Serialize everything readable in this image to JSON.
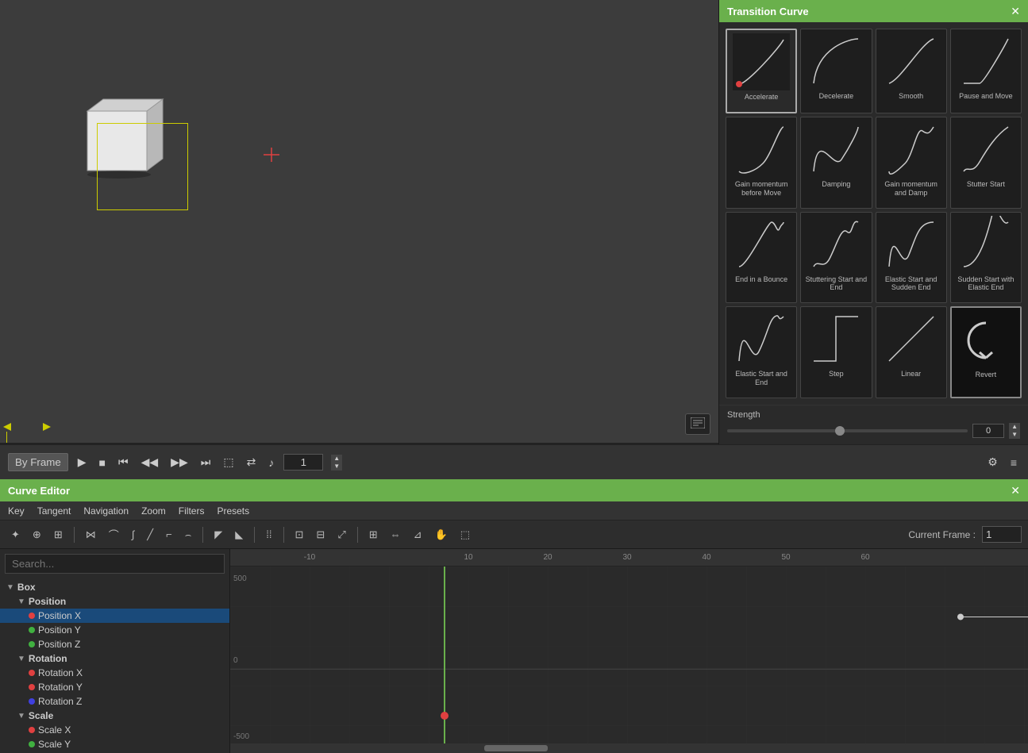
{
  "transition_panel": {
    "title": "Transition Curve",
    "close_btn": "✕",
    "curves": [
      {
        "id": "accelerate",
        "label": "Accelerate",
        "selected": true,
        "curve_type": "accelerate"
      },
      {
        "id": "decelerate",
        "label": "Decelerate",
        "selected": false,
        "curve_type": "decelerate"
      },
      {
        "id": "smooth",
        "label": "Smooth",
        "selected": false,
        "curve_type": "smooth"
      },
      {
        "id": "pause-move",
        "label": "Pause and Move",
        "selected": false,
        "curve_type": "pause_move"
      },
      {
        "id": "gain-momentum",
        "label": "Gain momentum before Move",
        "selected": false,
        "curve_type": "gain_momentum"
      },
      {
        "id": "damping",
        "label": "Damping",
        "selected": false,
        "curve_type": "damping"
      },
      {
        "id": "gain-damp",
        "label": "Gain momentum and Damp",
        "selected": false,
        "curve_type": "gain_damp"
      },
      {
        "id": "stutter-start",
        "label": "Stutter Start",
        "selected": false,
        "curve_type": "stutter_start"
      },
      {
        "id": "end-bounce",
        "label": "End in a Bounce",
        "selected": false,
        "curve_type": "end_bounce"
      },
      {
        "id": "stutter-start-end",
        "label": "Stuttering Start and End",
        "selected": false,
        "curve_type": "stutter_start_end"
      },
      {
        "id": "elastic-sudden",
        "label": "Elastic Start and Sudden End",
        "selected": false,
        "curve_type": "elastic_sudden"
      },
      {
        "id": "sudden-elastic",
        "label": "Sudden Start with Elastic End",
        "selected": false,
        "curve_type": "sudden_elastic"
      },
      {
        "id": "elastic-both",
        "label": "Elastic Start and End",
        "selected": false,
        "curve_type": "elastic_both"
      },
      {
        "id": "step",
        "label": "Step",
        "selected": false,
        "curve_type": "step"
      },
      {
        "id": "linear",
        "label": "Linear",
        "selected": false,
        "curve_type": "linear"
      },
      {
        "id": "revert",
        "label": "Revert",
        "selected": false,
        "dark": true,
        "curve_type": "revert"
      }
    ],
    "strength": {
      "label": "Strength",
      "value": "0"
    }
  },
  "curve_editor": {
    "title": "Curve Editor",
    "close_btn": "✕",
    "menu_items": [
      "Key",
      "Tangent",
      "Navigation",
      "Zoom",
      "Filters",
      "Presets"
    ],
    "current_frame_label": "Current Frame :",
    "current_frame_value": "1",
    "search_placeholder": "Search...",
    "tree": [
      {
        "id": "box",
        "label": "Box",
        "level": 0,
        "type": "parent",
        "expanded": true
      },
      {
        "id": "position",
        "label": "Position",
        "level": 1,
        "type": "parent",
        "expanded": true
      },
      {
        "id": "position-x",
        "label": "Position X",
        "level": 2,
        "type": "leaf",
        "dot": "red",
        "selected": true
      },
      {
        "id": "position-y",
        "label": "Position Y",
        "level": 2,
        "type": "leaf",
        "dot": "green"
      },
      {
        "id": "position-z",
        "label": "Position Z",
        "level": 2,
        "type": "leaf",
        "dot": "green"
      },
      {
        "id": "rotation",
        "label": "Rotation",
        "level": 1,
        "type": "parent",
        "expanded": true
      },
      {
        "id": "rotation-x",
        "label": "Rotation X",
        "level": 2,
        "type": "leaf",
        "dot": "red"
      },
      {
        "id": "rotation-y",
        "label": "Rotation Y",
        "level": 2,
        "type": "leaf",
        "dot": "red"
      },
      {
        "id": "rotation-z",
        "label": "Rotation Z",
        "level": 2,
        "type": "leaf",
        "dot": "blue"
      },
      {
        "id": "scale",
        "label": "Scale",
        "level": 1,
        "type": "parent",
        "expanded": true
      },
      {
        "id": "scale-x",
        "label": "Scale X",
        "level": 2,
        "type": "leaf",
        "dot": "red"
      },
      {
        "id": "scale-y",
        "label": "Scale Y",
        "level": 2,
        "type": "leaf",
        "dot": "green"
      }
    ],
    "ruler": {
      "ticks": [
        "-10",
        "10",
        "20",
        "30",
        "40",
        "50",
        "60"
      ],
      "tick_positions": [
        14,
        28,
        42,
        57,
        71,
        85,
        99
      ]
    },
    "y_labels": [
      "500",
      "0",
      "-500"
    ]
  },
  "playback": {
    "by_frame_label": "By Frame",
    "frame_value": "1",
    "icons": {
      "play": "▶",
      "stop": "■",
      "prev_key": "⏮",
      "prev": "◀◀",
      "next": "▶▶",
      "next_key": "⏭",
      "loop": "⬚",
      "bounce": "⇄",
      "audio": "♪",
      "settings": "⚙",
      "timeline": "≡"
    }
  }
}
